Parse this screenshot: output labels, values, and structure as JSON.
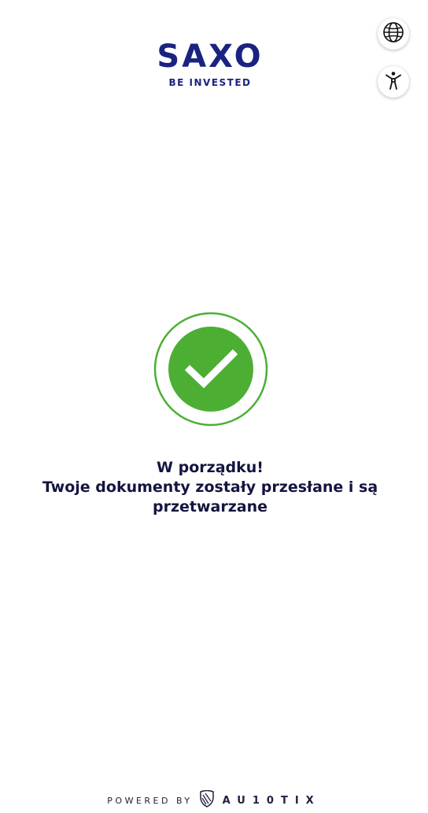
{
  "header": {
    "logo_text": "SAXO",
    "logo_tagline": "BE INVESTED"
  },
  "controls": {
    "language_icon": "globe-icon",
    "accessibility_icon": "accessibility-icon"
  },
  "status": {
    "icon": "check-circle-icon",
    "color": "#4caf34",
    "line1": "W porządku!",
    "line2": "Twoje dokumenty zostały przesłane i są",
    "line3": "przetwarzane"
  },
  "footer": {
    "powered_by": "POWERED BY",
    "brand": "AU10TIX",
    "brand_icon": "shield-logo-icon"
  },
  "colors": {
    "brand_navy": "#1a2380",
    "text": "#141440",
    "success_green": "#4caf34"
  }
}
